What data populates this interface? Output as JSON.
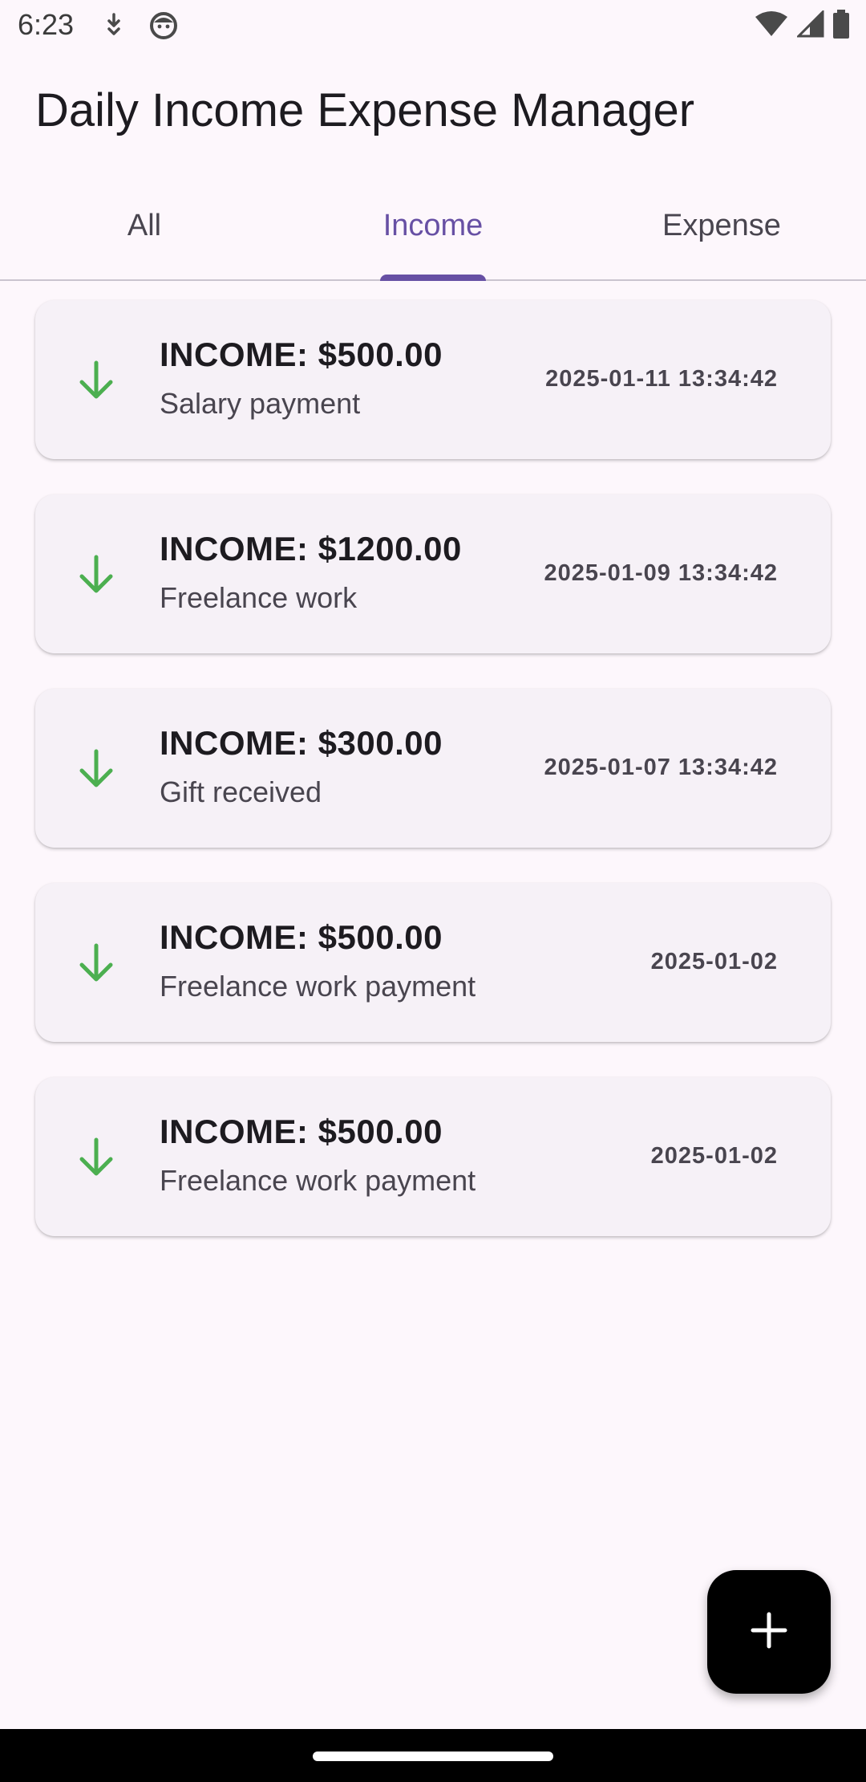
{
  "status_bar": {
    "time": "6:23",
    "left_icons": [
      "download-icon",
      "face-icon"
    ],
    "right_icons": [
      "wifi-icon",
      "cellular-signal-icon",
      "battery-icon"
    ]
  },
  "app_bar": {
    "title": "Daily Income Expense Manager"
  },
  "tabs": [
    {
      "label": "All",
      "active": false
    },
    {
      "label": "Income",
      "active": true
    },
    {
      "label": "Expense",
      "active": false
    }
  ],
  "transactions": [
    {
      "amount": "INCOME: $500.00",
      "description": "Salary payment",
      "date": "2025-01-11 13:34:42",
      "icon": "arrow-down-icon"
    },
    {
      "amount": "INCOME: $1200.00",
      "description": "Freelance work",
      "date": "2025-01-09 13:34:42",
      "icon": "arrow-down-icon"
    },
    {
      "amount": "INCOME: $300.00",
      "description": "Gift received",
      "date": "2025-01-07 13:34:42",
      "icon": "arrow-down-icon"
    },
    {
      "amount": "INCOME: $500.00",
      "description": "Freelance work payment",
      "date": "2025-01-02",
      "icon": "arrow-down-icon"
    },
    {
      "amount": "INCOME: $500.00",
      "description": "Freelance work payment",
      "date": "2025-01-02",
      "icon": "arrow-down-icon"
    }
  ],
  "fab": {
    "icon": "plus-icon"
  },
  "colors": {
    "accent": "#6750a4",
    "income_arrow": "#4caf50",
    "background": "#fdf7fc",
    "card": "#f6f1f7"
  }
}
